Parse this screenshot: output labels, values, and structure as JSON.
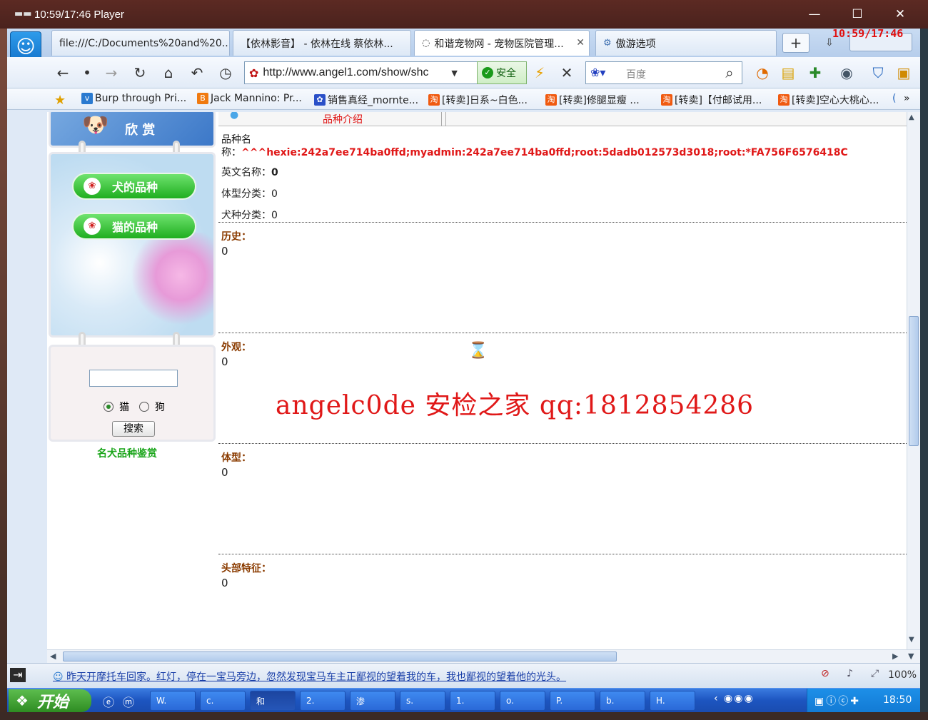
{
  "player": {
    "title": "10:59/17:46 Player",
    "icon": "video-icon"
  },
  "overlay_clock": "10:59/17:46",
  "tabs": [
    {
      "label": "file:///C:/Documents%20and%20...",
      "active": false
    },
    {
      "label": "【依林影音】 - 依林在线 蔡依林...",
      "active": false
    },
    {
      "label": "和谐宠物网 - 宠物医院管理...",
      "active": true
    },
    {
      "label": "傲游选项",
      "active": false
    }
  ],
  "address": {
    "url": "http://www.angel1.com/show/shc",
    "safe_label": "安全"
  },
  "search": {
    "placeholder": "百度"
  },
  "bookmarks": [
    "Burp through Pri...",
    "Jack Mannino: Pr...",
    "销售真经_mornte...",
    "[转卖]日系~白色...",
    "[转卖]修腿显瘦 ...",
    "[转卖]【付邮试用...",
    "[转卖]空心大桃心...",
    "("
  ],
  "sidebar": {
    "banner": "欣 赏",
    "dog_button": "犬的品种",
    "cat_button": "猫的品种",
    "radio_cat": "猫",
    "radio_dog": "狗",
    "search_button": "搜索",
    "caption": "名犬品种鉴赏"
  },
  "main": {
    "top_tab": "品种介绍",
    "name_label": "品种名",
    "name_label2": "称：",
    "name_value": "^^^hexie:242a7ee714ba0ffd;myadmin:242a7ee714ba0ffd;root:5dadb012573d3018;root:*FA756F6576418C",
    "english_label": "英文名称：",
    "english_value": "0",
    "body_type_label": "体型分类：",
    "body_type_value": "0",
    "dog_type_label": "犬种分类：",
    "dog_type_value": "0",
    "history_label": "历史：",
    "history_value": "0",
    "appearance_label": "外观：",
    "appearance_value": "0",
    "physique_label": "体型：",
    "physique_value": "0",
    "head_label": "头部特征：",
    "head_value": "0"
  },
  "watermark": "angelc0de 安检之家 qq:1812854286",
  "status": {
    "text": "昨天开摩托车回家。红灯，停在一宝马旁边，忽然发现宝马车主正鄙视的望着我的车，我也鄙视的望着他的光头。",
    "zoom": "100%"
  },
  "taskbar": {
    "start": "开始",
    "items": [
      "W.",
      "c.",
      "和",
      "2.",
      "渗",
      "s.",
      "1.",
      "o.",
      "P.",
      "b.",
      "H."
    ],
    "time": "18:50"
  },
  "colors": {
    "accent_red": "#e01818",
    "header_brown": "#8a3b00",
    "taskbar_blue": "#2a69d8",
    "green_button": "#1fae1f"
  }
}
